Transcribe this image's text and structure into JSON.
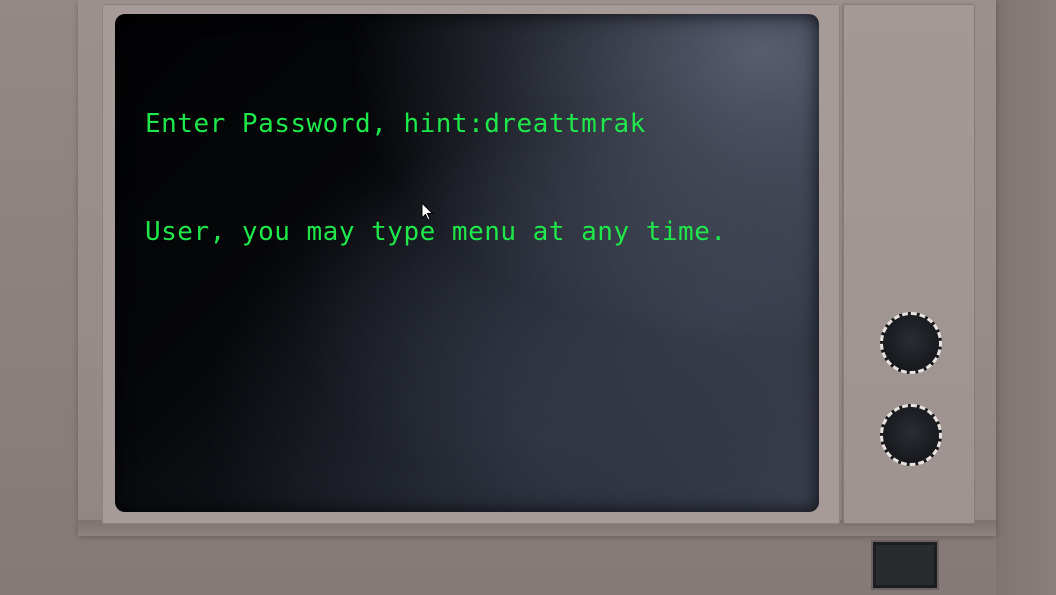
{
  "terminal": {
    "lines": [
      "Enter Password, hint:dreattmrak",
      "User, you may type menu at any time."
    ],
    "text_color": "#1ee84a",
    "screen_color": "#06070a"
  },
  "controls": {
    "knobs": [
      "knob-icon",
      "knob-icon"
    ],
    "power_button": "power-button-icon"
  },
  "pointer": "mouse-pointer-icon"
}
